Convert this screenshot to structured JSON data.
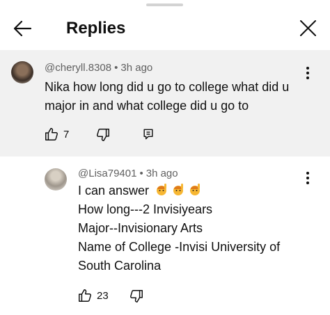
{
  "header": {
    "title": "Replies"
  },
  "parent_comment": {
    "username": "@cheryll.8308",
    "separator": "•",
    "time": "3h ago",
    "text": "Nika how long did u go to college what  did u major in and what  college did  u go to",
    "likes": "7"
  },
  "reply_comment": {
    "username": "@Lisa79401",
    "separator": "•",
    "time": "3h ago",
    "lines": [
      "I can answer",
      "How long---2 Invisiyears",
      "Major--Invisionary Arts",
      "Name of College -Invisi University of",
      "South Carolina"
    ],
    "likes": "23"
  },
  "icons": {
    "back": "arrow-left-icon",
    "close": "close-icon",
    "like": "thumbs-up-icon",
    "dislike": "thumbs-down-icon",
    "reply": "reply-comment-icon",
    "more": "more-vertical-icon",
    "emoji": "raising-hand-emoji"
  }
}
